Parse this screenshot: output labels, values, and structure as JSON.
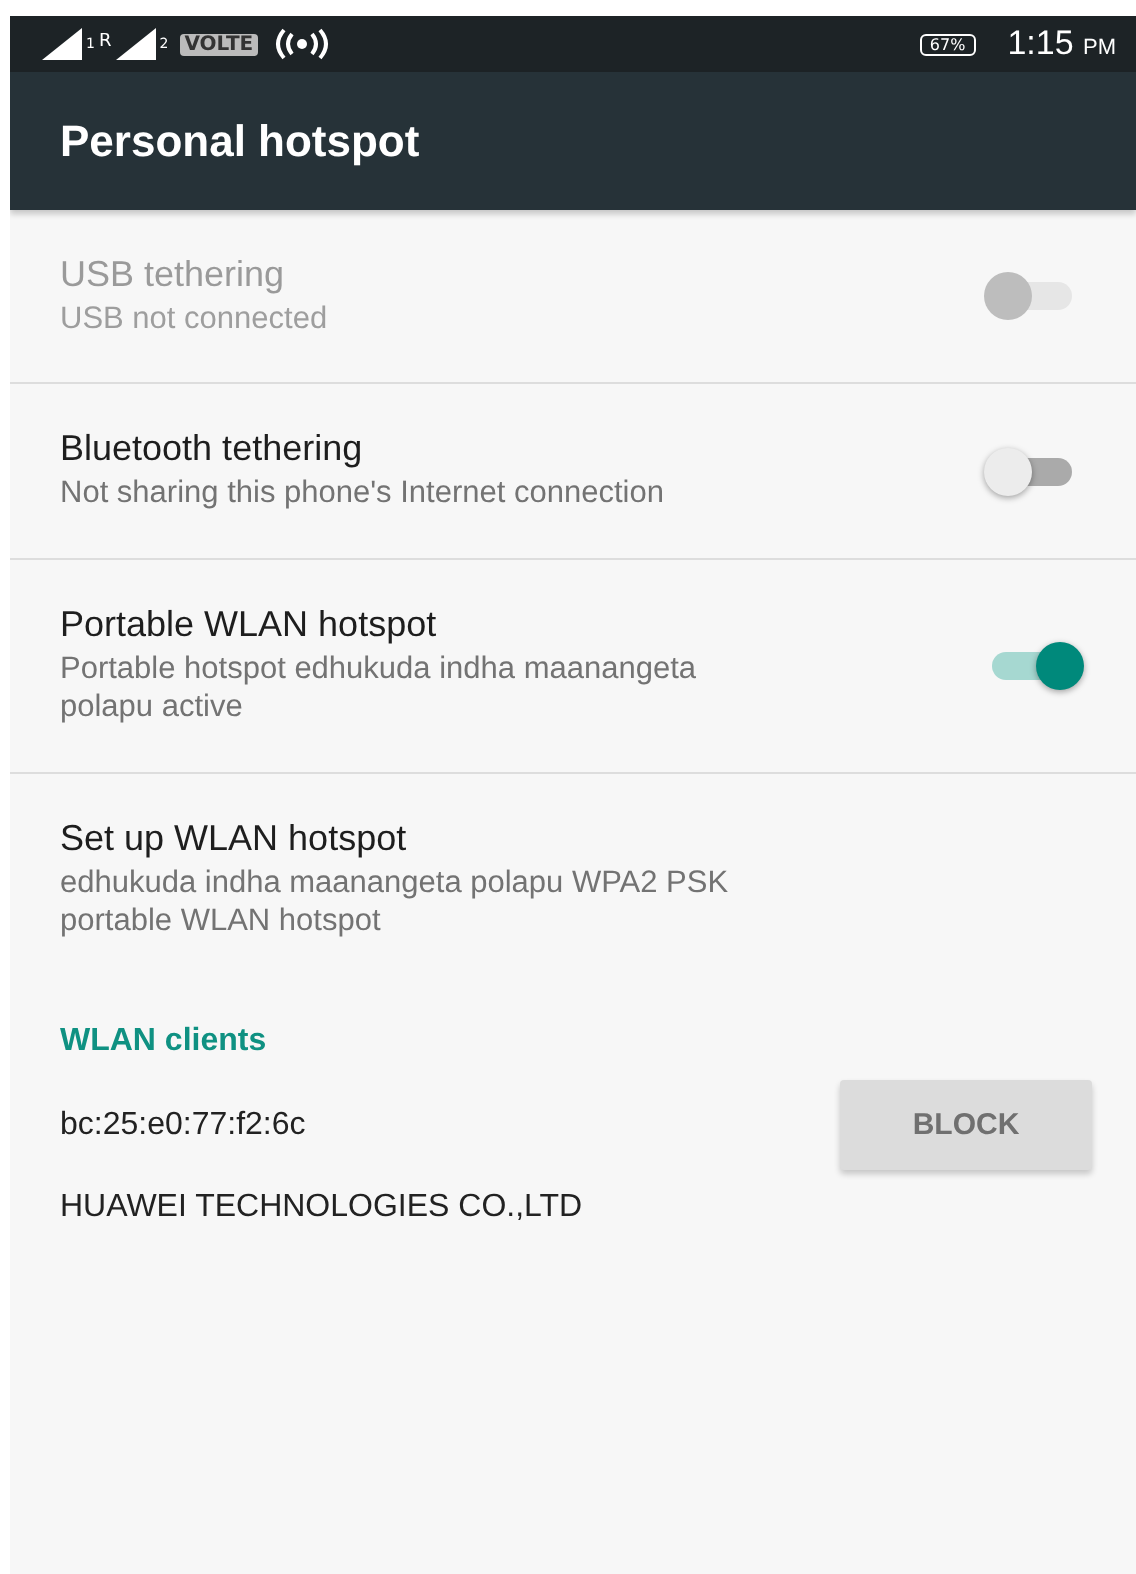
{
  "status_bar": {
    "sim_labels": [
      "1",
      "R",
      "2"
    ],
    "volte": "VOLTE",
    "battery": "67%",
    "time": "1:15",
    "ampm": "PM"
  },
  "app_bar": {
    "title": "Personal hotspot"
  },
  "settings": [
    {
      "kind": "toggle",
      "title": "USB tethering",
      "summary": "USB not connected",
      "disabled": true,
      "on": false
    },
    {
      "kind": "toggle",
      "title": "Bluetooth tethering",
      "summary": "Not sharing this phone's Internet connection",
      "disabled": false,
      "on": false
    },
    {
      "kind": "toggle",
      "title": "Portable WLAN hotspot",
      "summary": "Portable hotspot edhukuda indha maanangeta polapu active",
      "disabled": false,
      "on": true
    },
    {
      "kind": "plain",
      "title": "Set up WLAN hotspot",
      "summary": "edhukuda indha maanangeta polapu WPA2 PSK portable WLAN hotspot",
      "disabled": false
    }
  ],
  "clients": {
    "header": "WLAN clients",
    "items": [
      {
        "mac": "bc:25:e0:77:f2:6c",
        "vendor": "HUAWEI TECHNOLOGIES CO.,LTD",
        "button": "BLOCK"
      }
    ]
  }
}
